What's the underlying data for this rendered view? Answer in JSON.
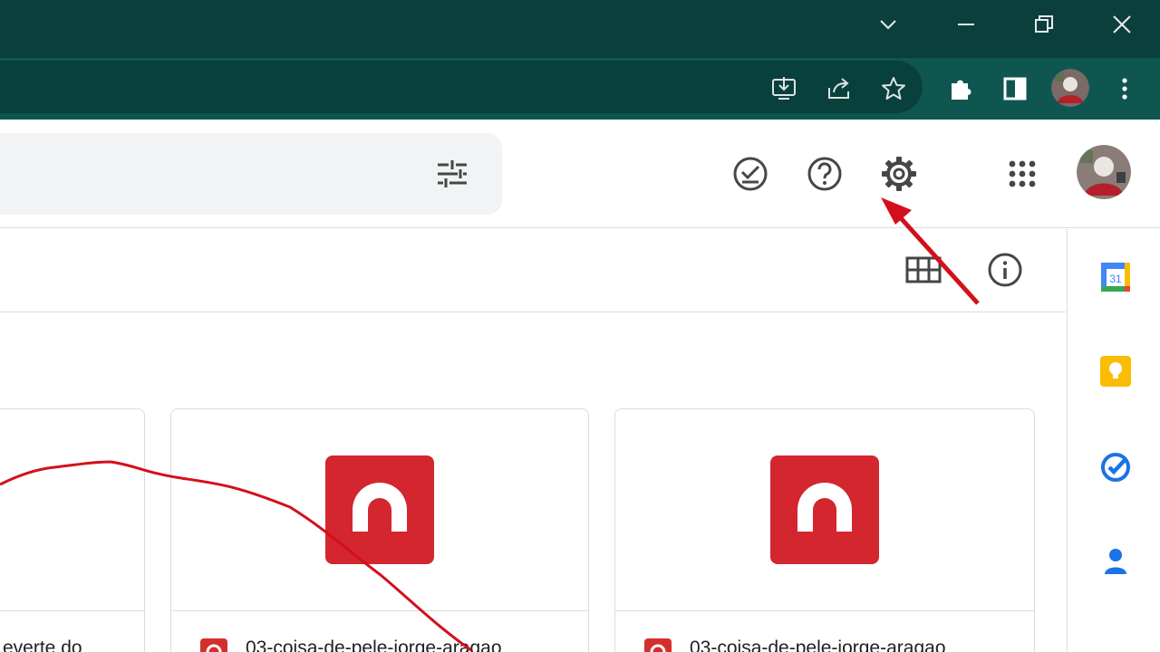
{
  "window": {
    "controls": [
      "chevron-down",
      "minimize",
      "restore",
      "close"
    ]
  },
  "browser": {
    "icons": [
      "install-app-icon",
      "share-icon",
      "bookmark-star-icon",
      "extensions-icon",
      "side-panel-icon",
      "profile-avatar",
      "more-vert-icon"
    ]
  },
  "header": {
    "header_icons": [
      "filter-options-icon",
      "ready-for-offline-icon",
      "help-icon",
      "settings-icon",
      "apps-grid-icon",
      "account-avatar"
    ]
  },
  "toolbar": {
    "view_icons": [
      "grid-view-icon",
      "info-icon"
    ]
  },
  "files": [
    {
      "name": "everte do"
    },
    {
      "name": "03-coisa-de-pele-jorge-aragao"
    },
    {
      "name": "03-coisa-de-pele-jorge-aragao"
    }
  ],
  "side_panel": {
    "apps": [
      "calendar",
      "keep",
      "tasks",
      "contacts"
    ],
    "calendar_date": "31"
  },
  "colors": {
    "title_bar": "#0b3f3c",
    "toolbar": "#0f5651",
    "audio_red": "#d3262f",
    "annotation_red": "#d40f1c"
  }
}
